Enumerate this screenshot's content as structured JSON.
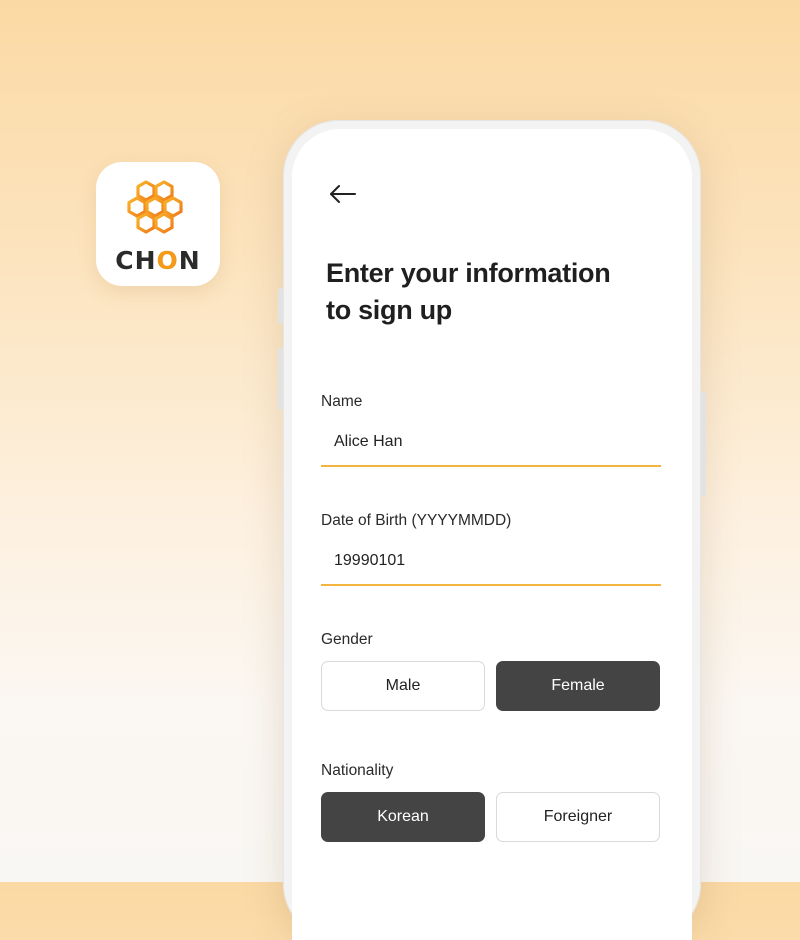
{
  "app_icon": {
    "brand_text_pre": "CH",
    "brand_text_o": "O",
    "brand_text_post": "N",
    "accent_color": "#f39a1a"
  },
  "screen": {
    "title_line1": "Enter your information",
    "title_line2": "to sign up",
    "name": {
      "label": "Name",
      "value": "Alice Han"
    },
    "dob": {
      "label": "Date of Birth (YYYYMMDD)",
      "value": "19990101"
    },
    "gender": {
      "label": "Gender",
      "options": [
        "Male",
        "Female"
      ],
      "selected": "Female"
    },
    "nationality": {
      "label": "Nationality",
      "options": [
        "Korean",
        "Foreigner"
      ],
      "selected": "Korean"
    }
  },
  "colors": {
    "underline": "#f2b53d",
    "selected_button": "#444444"
  }
}
